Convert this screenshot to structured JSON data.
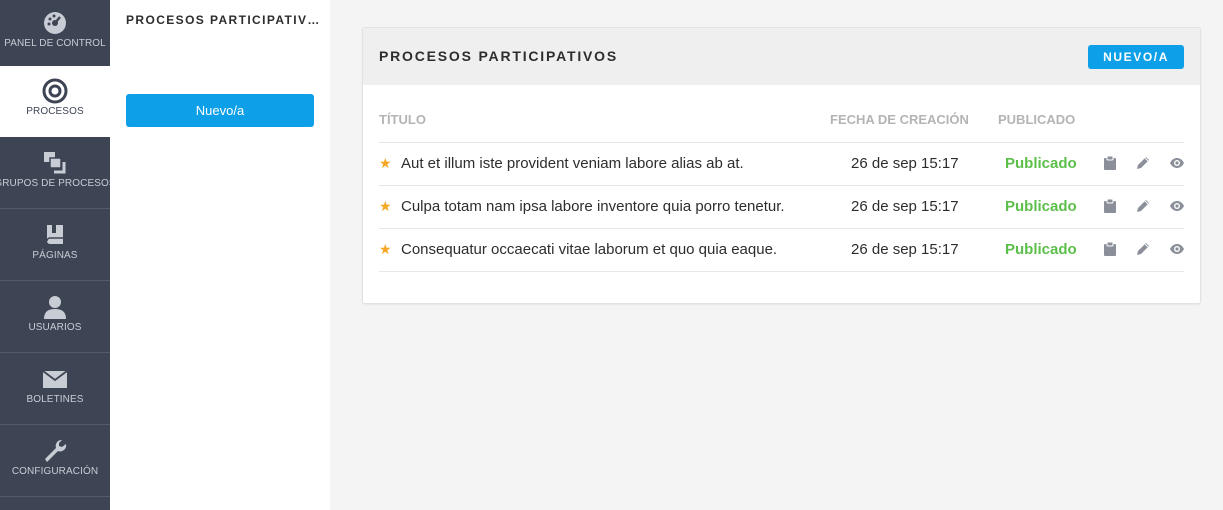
{
  "nav": {
    "items": [
      {
        "label": "PANEL DE CONTROL",
        "icon": "dashboard-icon"
      },
      {
        "label": "PROCESOS",
        "icon": "target-icon"
      },
      {
        "label": "GRUPOS DE PROCESOS",
        "icon": "process-groups-icon"
      },
      {
        "label": "PÁGINAS",
        "icon": "book-icon"
      },
      {
        "label": "USUARIOS",
        "icon": "user-icon"
      },
      {
        "label": "BOLETINES",
        "icon": "envelope-icon"
      },
      {
        "label": "CONFIGURACIÓN",
        "icon": "wrench-icon"
      }
    ],
    "active": "PROCESOS"
  },
  "subnav": {
    "title": "PROCESOS PARTICIPATIVOS",
    "new_label": "Nuevo/a"
  },
  "card": {
    "title": "PROCESOS PARTICIPATIVOS",
    "new_label": "NUEVO/A",
    "columns": [
      "TÍTULO",
      "FECHA DE CREACIÓN",
      "PUBLICADO"
    ],
    "rows": [
      {
        "title": "Aut et illum iste provident veniam labore alias ab at.",
        "date": "26 de sep 15:17",
        "status": "Publicado",
        "featured": true
      },
      {
        "title": "Culpa totam nam ipsa labore inventore quia porro tenetur.",
        "date": "26 de sep 15:17",
        "status": "Publicado",
        "featured": true
      },
      {
        "title": "Consequatur occaecati vitae laborum et quo quia eaque.",
        "date": "26 de sep 15:17",
        "status": "Publicado",
        "featured": true
      }
    ],
    "row_actions": [
      "clipboard-icon",
      "pencil-icon",
      "eye-icon"
    ]
  },
  "colors": {
    "sidebar": "#3d4454",
    "accent": "#0d9fe8",
    "published": "#5cbf4a",
    "star": "#f5a623"
  }
}
